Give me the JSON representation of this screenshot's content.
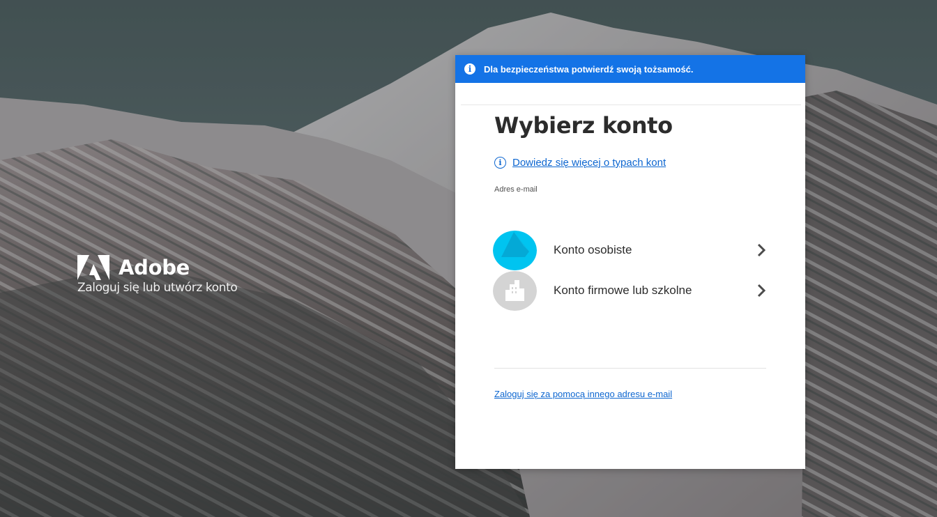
{
  "brand": {
    "name": "Adobe",
    "tagline": "Zaloguj się lub utwórz konto",
    "logo_icon": "adobe-logo-icon"
  },
  "banner": {
    "icon": "info-icon",
    "text": "Dla bezpieczeństwa potwierdź swoją tożsamość."
  },
  "page": {
    "title": "Wybierz konto",
    "learn_more_link": "Dowiedz się więcej o typach kont",
    "email_label": "Adres e-mail"
  },
  "accounts": [
    {
      "label": "Konto osobiste",
      "icon": "personal-account-icon"
    },
    {
      "label": "Konto firmowe lub szkolne",
      "icon": "building-icon"
    }
  ],
  "footer": {
    "alt_email_link": "Zaloguj się za pomocą innego adresu e-mail"
  },
  "colors": {
    "banner": "#1473e6",
    "link": "#0d66d0",
    "personal_avatar": "#00c4f0",
    "business_avatar": "#d4d4d4"
  }
}
